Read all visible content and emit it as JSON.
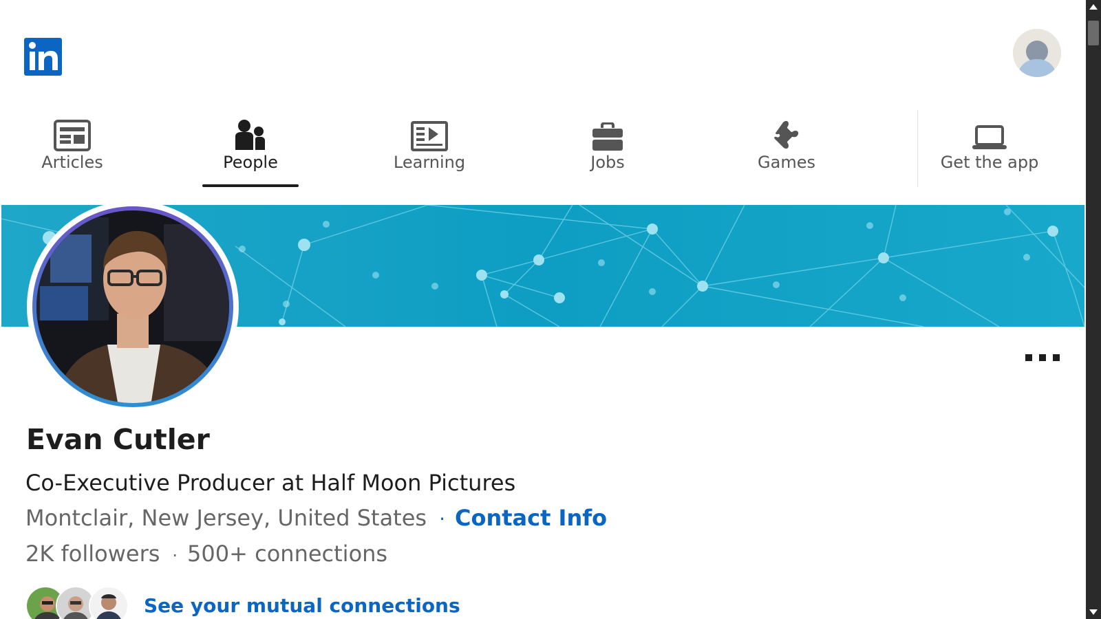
{
  "brand": {
    "logo_text": "in",
    "color": "#0a66c2"
  },
  "nav": {
    "items": [
      {
        "label": "Articles",
        "icon": "articles-icon"
      },
      {
        "label": "People",
        "icon": "people-icon",
        "active": true
      },
      {
        "label": "Learning",
        "icon": "learning-icon"
      },
      {
        "label": "Jobs",
        "icon": "jobs-icon"
      },
      {
        "label": "Games",
        "icon": "games-icon"
      },
      {
        "label": "Get the app",
        "icon": "laptop-icon"
      }
    ]
  },
  "profile": {
    "name": "Evan Cutler",
    "headline": "Co-Executive Producer at Half Moon Pictures",
    "location": "Montclair, New Jersey, United States",
    "location_separator": "·",
    "contact_label": "Contact Info",
    "followers": "2K followers",
    "stats_separator": "·",
    "connections": "500+ connections",
    "mutual_label": "See your mutual connections"
  },
  "colors": {
    "link": "#0a66c2",
    "banner": "#14a3c7",
    "photo_ring": "#4a6ec2"
  }
}
